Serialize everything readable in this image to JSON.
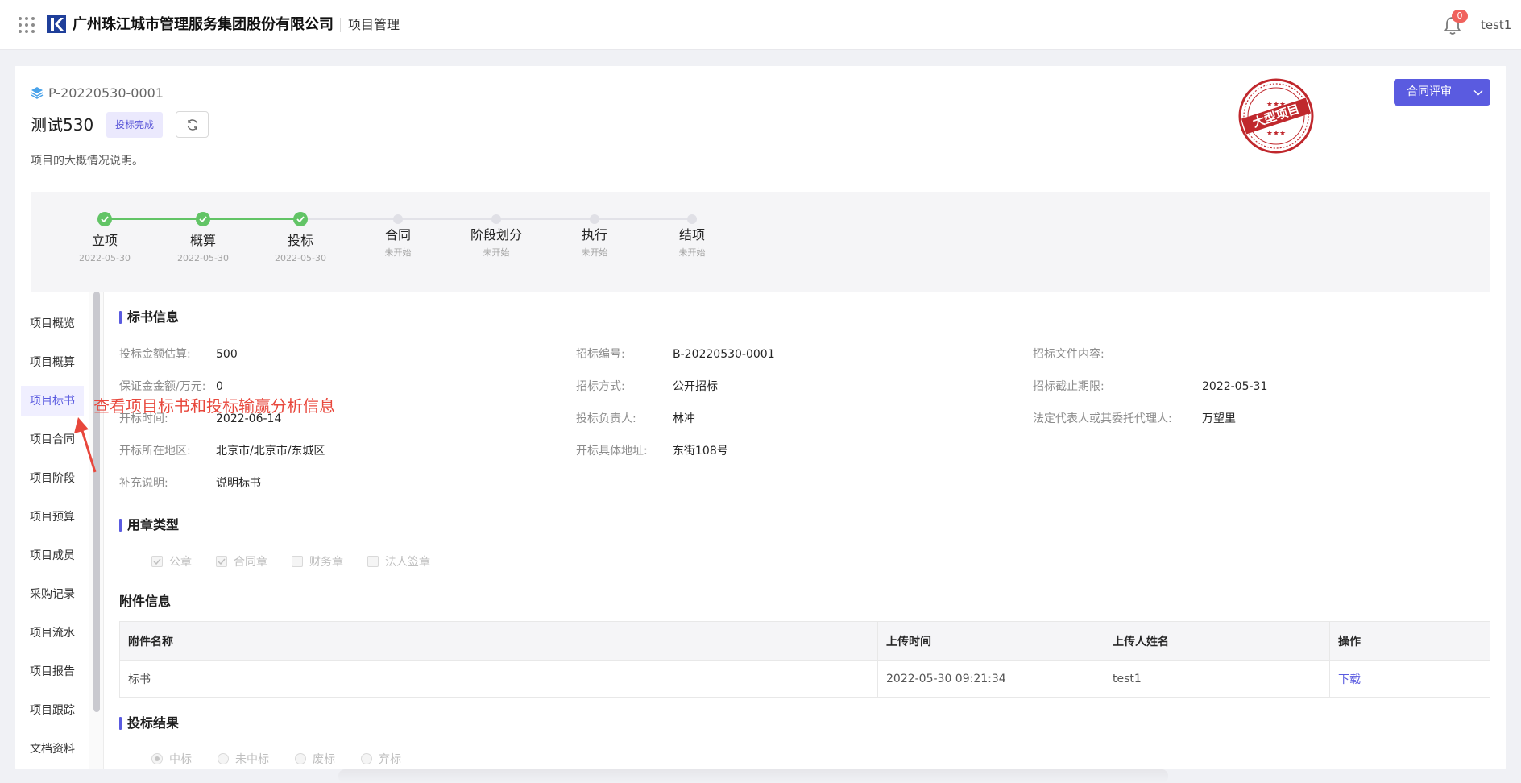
{
  "header": {
    "company": "广州珠江城市管理服务集团股份有限公司",
    "module": "项目管理",
    "notification_count": "0",
    "username": "test1"
  },
  "project": {
    "code": "P-20220530-0001",
    "name": "测试530",
    "status": "投标完成",
    "description": "项目的大概情况说明。",
    "seal_text": "大型项目",
    "review_button": "合同评审"
  },
  "steps": [
    {
      "label": "立项",
      "sub": "2022-05-30",
      "done": true
    },
    {
      "label": "概算",
      "sub": "2022-05-30",
      "done": true
    },
    {
      "label": "投标",
      "sub": "2022-05-30",
      "done": true
    },
    {
      "label": "合同",
      "sub": "未开始",
      "done": false
    },
    {
      "label": "阶段划分",
      "sub": "未开始",
      "done": false
    },
    {
      "label": "执行",
      "sub": "未开始",
      "done": false
    },
    {
      "label": "结项",
      "sub": "未开始",
      "done": false
    }
  ],
  "sidebar": {
    "items": [
      "项目概览",
      "项目概算",
      "项目标书",
      "项目合同",
      "项目阶段",
      "项目预算",
      "项目成员",
      "采购记录",
      "项目流水",
      "项目报告",
      "项目跟踪",
      "文档资料"
    ],
    "active": "项目标书"
  },
  "annotation": "查看项目标书和投标输赢分析信息",
  "bid_info": {
    "title": "标书信息",
    "fields": [
      {
        "label": "投标金额估算:",
        "value": "500"
      },
      {
        "label": "招标编号:",
        "value": "B-20220530-0001"
      },
      {
        "label": "招标文件内容:",
        "value": ""
      },
      {
        "label": "保证金金额/万元:",
        "value": "0"
      },
      {
        "label": "招标方式:",
        "value": "公开招标"
      },
      {
        "label": "招标截止期限:",
        "value": "2022-05-31"
      },
      {
        "label": "开标时间:",
        "value": "2022-06-14"
      },
      {
        "label": "投标负责人:",
        "value": "林冲"
      },
      {
        "label": "法定代表人或其委托代理人:",
        "value": "万望里"
      },
      {
        "label": "开标所在地区:",
        "value": "北京市/北京市/东城区"
      },
      {
        "label": "开标具体地址:",
        "value": "东街108号"
      },
      {
        "label": "补充说明:",
        "value": "说明标书"
      }
    ]
  },
  "seal_type": {
    "title": "用章类型",
    "options": [
      {
        "label": "公章",
        "checked": true
      },
      {
        "label": "合同章",
        "checked": true
      },
      {
        "label": "财务章",
        "checked": false
      },
      {
        "label": "法人签章",
        "checked": false
      }
    ]
  },
  "attachments": {
    "title": "附件信息",
    "columns": [
      "附件名称",
      "上传时间",
      "上传人姓名",
      "操作"
    ],
    "rows": [
      {
        "name": "标书",
        "time": "2022-05-30 09:21:34",
        "uploader": "test1",
        "action": "下载"
      }
    ]
  },
  "bid_result": {
    "title": "投标结果",
    "options": [
      {
        "label": "中标",
        "selected": true
      },
      {
        "label": "未中标",
        "selected": false
      },
      {
        "label": "废标",
        "selected": false
      },
      {
        "label": "弃标",
        "selected": false
      }
    ]
  },
  "colors": {
    "primary": "#5a5be0",
    "success": "#62c466",
    "annotation": "#e8473c",
    "seal": "#c0282d"
  }
}
